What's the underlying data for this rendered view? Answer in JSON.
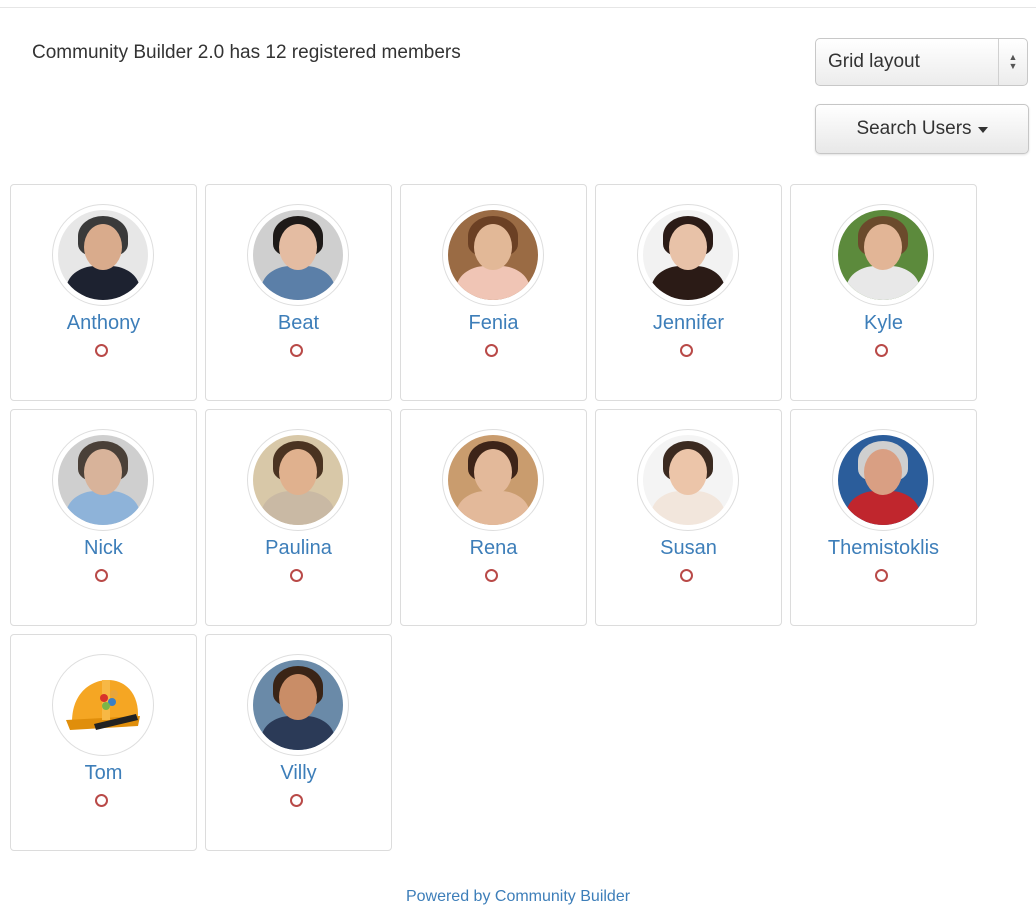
{
  "summary_text": "Community Builder 2.0 has 12 registered members",
  "layout_select": {
    "value": "Grid layout"
  },
  "search_button": {
    "label": "Search Users",
    "icon": "caret-down-icon"
  },
  "members": [
    {
      "name": "Anthony",
      "status": "offline",
      "skin": "#d9ab8c",
      "hair": "#3a3a3a",
      "shirt": "#1d2230",
      "bg": "#e7e7e7"
    },
    {
      "name": "Beat",
      "status": "offline",
      "skin": "#e4bca2",
      "hair": "#1e1a18",
      "shirt": "#5b7fa8",
      "bg": "#cfcfcf"
    },
    {
      "name": "Fenia",
      "status": "offline",
      "skin": "#e2b897",
      "hair": "#6b4024",
      "shirt": "#f0c5b5",
      "bg": "#9a6b44"
    },
    {
      "name": "Jennifer",
      "status": "offline",
      "skin": "#e8c2a8",
      "hair": "#2b1b16",
      "shirt": "#2b1b16",
      "bg": "#f2f2f2"
    },
    {
      "name": "Kyle",
      "status": "offline",
      "skin": "#e2b596",
      "hair": "#6b4a2c",
      "shirt": "#e8e8e8",
      "bg": "#5c8a3c"
    },
    {
      "name": "Nick",
      "status": "offline",
      "skin": "#d8b39a",
      "hair": "#4a4038",
      "shirt": "#8eb3d9",
      "bg": "#cfcfcf"
    },
    {
      "name": "Paulina",
      "status": "offline",
      "skin": "#e0b18e",
      "hair": "#4a3321",
      "shirt": "#c9b9a4",
      "bg": "#d8c8a8"
    },
    {
      "name": "Rena",
      "status": "offline",
      "skin": "#e3b99a",
      "hair": "#3d2418",
      "shirt": "#e3b99a",
      "bg": "#c99c6e"
    },
    {
      "name": "Susan",
      "status": "offline",
      "skin": "#ecc5a9",
      "hair": "#3b2a20",
      "shirt": "#f2e6dc",
      "bg": "#f4f4f4"
    },
    {
      "name": "Themistoklis",
      "status": "offline",
      "skin": "#d99f83",
      "hair": "#cfcfcf",
      "shirt": "#c0262d",
      "bg": "#2b5d9b"
    },
    {
      "name": "Tom",
      "status": "offline",
      "avatar_icon": "hard-hat-icon"
    },
    {
      "name": "Villy",
      "status": "offline",
      "skin": "#c98d67",
      "hair": "#3a2416",
      "shirt": "#2b3a57",
      "bg": "#6a8aa8"
    }
  ],
  "footer": {
    "link_text": "Powered by Community Builder"
  },
  "colors": {
    "link": "#3d7eb9",
    "status_offline": "#b94a48"
  }
}
